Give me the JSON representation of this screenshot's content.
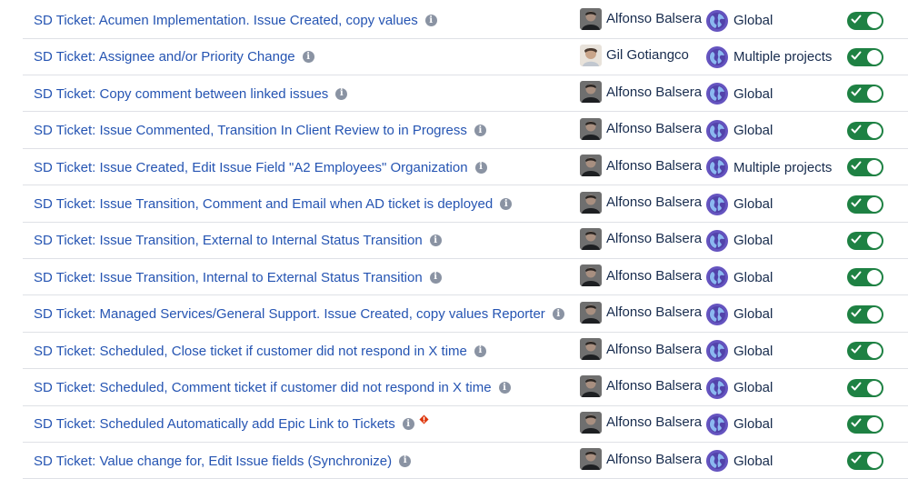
{
  "rules": [
    {
      "name": "SD Ticket: Acumen Implementation. Issue Created, copy values",
      "owner": "Alfonso Balsera",
      "owner_avatar": "alfonso",
      "scope": "Global",
      "enabled": true,
      "warning": false
    },
    {
      "name": "SD Ticket: Assignee and/or Priority Change",
      "owner": "Gil Gotiangco",
      "owner_avatar": "gil",
      "scope": "Multiple projects",
      "enabled": true,
      "warning": false
    },
    {
      "name": "SD Ticket: Copy comment between linked issues",
      "owner": "Alfonso Balsera",
      "owner_avatar": "alfonso",
      "scope": "Global",
      "enabled": true,
      "warning": false
    },
    {
      "name": "SD Ticket: Issue Commented, Transition In Client Review to in Progress",
      "owner": "Alfonso Balsera",
      "owner_avatar": "alfonso",
      "scope": "Global",
      "enabled": true,
      "warning": false
    },
    {
      "name": "SD Ticket: Issue Created, Edit Issue Field \"A2 Employees\" Organization",
      "owner": "Alfonso Balsera",
      "owner_avatar": "alfonso",
      "scope": "Multiple projects",
      "enabled": true,
      "warning": false
    },
    {
      "name": "SD Ticket: Issue Transition, Comment and Email when AD ticket is deployed",
      "owner": "Alfonso Balsera",
      "owner_avatar": "alfonso",
      "scope": "Global",
      "enabled": true,
      "warning": false
    },
    {
      "name": "SD Ticket: Issue Transition, External to Internal Status Transition",
      "owner": "Alfonso Balsera",
      "owner_avatar": "alfonso",
      "scope": "Global",
      "enabled": true,
      "warning": false
    },
    {
      "name": "SD Ticket: Issue Transition, Internal to External Status Transition",
      "owner": "Alfonso Balsera",
      "owner_avatar": "alfonso",
      "scope": "Global",
      "enabled": true,
      "warning": false
    },
    {
      "name": "SD Ticket: Managed Services/General Support. Issue Created, copy values Reporter",
      "owner": "Alfonso Balsera",
      "owner_avatar": "alfonso",
      "scope": "Global",
      "enabled": true,
      "warning": false
    },
    {
      "name": "SD Ticket: Scheduled, Close ticket if customer did not respond in X time",
      "owner": "Alfonso Balsera",
      "owner_avatar": "alfonso",
      "scope": "Global",
      "enabled": true,
      "warning": false
    },
    {
      "name": "SD Ticket: Scheduled, Comment ticket if customer did not respond in X time",
      "owner": "Alfonso Balsera",
      "owner_avatar": "alfonso",
      "scope": "Global",
      "enabled": true,
      "warning": false
    },
    {
      "name": "SD Ticket: Scheduled Automatically add Epic Link to Tickets",
      "owner": "Alfonso Balsera",
      "owner_avatar": "alfonso",
      "scope": "Global",
      "enabled": true,
      "warning": true
    },
    {
      "name": "SD Ticket: Value change for, Edit Issue fields (Synchronize)",
      "owner": "Alfonso Balsera",
      "owner_avatar": "alfonso",
      "scope": "Global",
      "enabled": true,
      "warning": false
    }
  ],
  "icons": {
    "info": "info-icon",
    "warning": "warning-diamond-icon",
    "scope": "globe-icon",
    "toggle_on": "checkmark-icon"
  },
  "colors": {
    "link": "#2554b2",
    "toggle_on": "#1e8143",
    "info_icon": "#8a93a3",
    "warning": "#de350b",
    "globe": "#6554c0"
  }
}
